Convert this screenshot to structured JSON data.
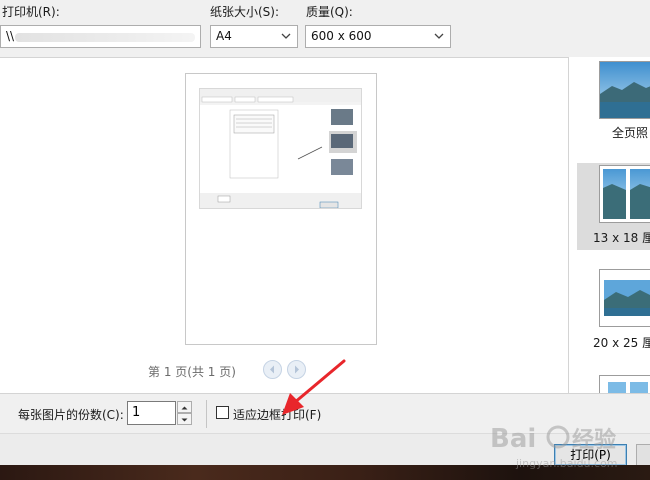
{
  "header": {
    "printer_label": "打印机(R):",
    "printer_value": "\\\\",
    "paper_label": "纸张大小(S):",
    "paper_value": "A4",
    "quality_label": "质量(Q):",
    "quality_value": "600 x 600"
  },
  "preview": {
    "page_indicator": "第 1 页(共 1 页)"
  },
  "sidebar": {
    "items": [
      {
        "label": "全页照"
      },
      {
        "label": "13 x 18 厘"
      },
      {
        "label": "20 x 25 厘"
      }
    ]
  },
  "options": {
    "copies_label": "每张图片的份数(C):",
    "copies_value": "1",
    "fit_label": "适应边框打印(F)",
    "fit_checked": false
  },
  "footer": {
    "print_label": "打印(P)"
  },
  "colors": {
    "annotation_arrow": "#e8262b",
    "selected_item": "#dcdcdc",
    "print_button_border": "#3c7fb1"
  },
  "icons": [
    "chevron-down-icon",
    "prev-page-icon",
    "next-page-icon",
    "spin-up-icon",
    "spin-down-icon",
    "red-arrow-annotation"
  ]
}
